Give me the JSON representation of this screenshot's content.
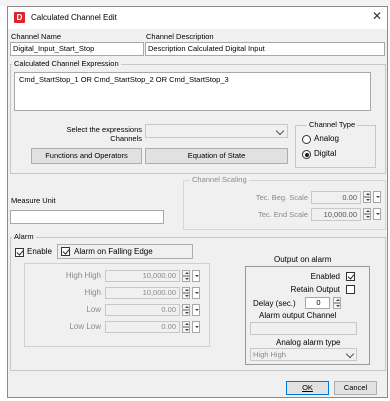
{
  "window": {
    "title": "Calculated Channel Edit",
    "close_icon": "close-icon",
    "app_icon_letter": "D"
  },
  "channel": {
    "name_label": "Channel Name",
    "name_value": "Digital_Input_Start_Stop",
    "description_label": "Channel Description",
    "description_value": "Description Calculated Digital Input"
  },
  "expression": {
    "group_label": "Calculated Channel Expression",
    "value": "Cmd_StartStop_1 OR Cmd_StartStop_2 OR Cmd_StartStop_3",
    "select_label": "Select the expressions Channels",
    "functions_button": "Functions and Operators",
    "equation_button": "Equation of State"
  },
  "channel_type": {
    "label": "Channel Type",
    "options": [
      "Analog",
      "Digital"
    ],
    "selected": "Digital"
  },
  "scaling": {
    "label": "Channel Scaling",
    "beg_label": "Tec. Beg. Scale",
    "beg_value": "0.00",
    "end_label": "Tec. End Scale",
    "end_value": "10,000.00"
  },
  "measure_unit": {
    "label": "Measure Unit",
    "value": ""
  },
  "alarm": {
    "group_label": "Alarm",
    "enable_label": "Enable",
    "enable_checked": true,
    "falling_edge_label": "Alarm on Falling Edge",
    "falling_edge_checked": true,
    "levels": [
      {
        "label": "High High",
        "value": "10,000.00"
      },
      {
        "label": "High",
        "value": "10,000.00"
      },
      {
        "label": "Low",
        "value": "0.00"
      },
      {
        "label": "Low Low",
        "value": "0.00"
      }
    ]
  },
  "output": {
    "title": "Output on alarm",
    "enabled_label": "Enabled",
    "enabled_checked": true,
    "retain_label": "Retain Output",
    "retain_checked": false,
    "delay_label": "Delay (sec.)",
    "delay_value": "0",
    "channel_label": "Alarm output Channel",
    "channel_value": "",
    "analog_type_label": "Analog alarm type",
    "analog_type_value": "High High"
  },
  "buttons": {
    "ok": "OK",
    "cancel": "Cancel"
  }
}
